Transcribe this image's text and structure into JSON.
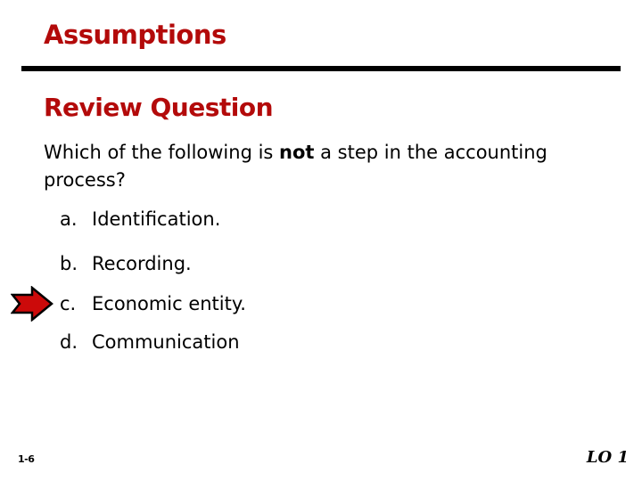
{
  "slide": {
    "title": "Assumptions",
    "section_title": "Review Question",
    "question": {
      "before": "Which of the following is ",
      "emphasis": "not",
      "after": " a step in the accounting process?"
    },
    "options": [
      {
        "letter": "a.",
        "text": "Identification."
      },
      {
        "letter": "b.",
        "text": "Recording."
      },
      {
        "letter": "c.",
        "text": "Economic entity."
      },
      {
        "letter": "d.",
        "text": "Communication"
      }
    ],
    "answer_indicator": {
      "icon": "arrow-right-icon",
      "points_to": "c.",
      "color": "#cc0a0a"
    },
    "accent_color": "#b30a0a",
    "footer": {
      "slide_number": "1-6",
      "learning_objective": "LO 1"
    }
  }
}
